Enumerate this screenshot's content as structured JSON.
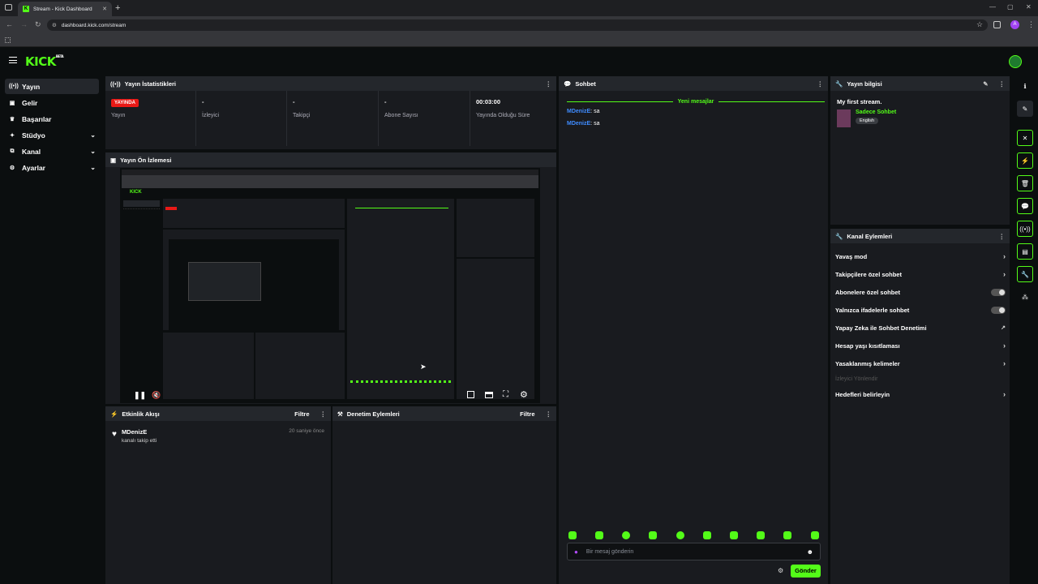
{
  "browser": {
    "tab_title": "Stream - Kick Dashboard",
    "url": "dashboard.kick.com/stream"
  },
  "brand": {
    "logo": "KICK",
    "logo_sup": "BETA",
    "accent": "#53fc18"
  },
  "sidebar": {
    "items": [
      {
        "label": "Yayın",
        "icon": "broadcast-icon",
        "active": true
      },
      {
        "label": "Gelir",
        "icon": "wallet-icon"
      },
      {
        "label": "Başarılar",
        "icon": "trophy-icon"
      },
      {
        "label": "Stüdyo",
        "icon": "studio-icon",
        "expandable": true
      },
      {
        "label": "Kanal",
        "icon": "channel-icon",
        "expandable": true
      },
      {
        "label": "Ayarlar",
        "icon": "gear-icon",
        "expandable": true
      }
    ]
  },
  "stats": {
    "title": "Yayın İstatistikleri",
    "live_badge": "YAYINDA",
    "items": [
      {
        "value": "",
        "label": "Yayın"
      },
      {
        "value": "-",
        "label": "İzleyici"
      },
      {
        "value": "-",
        "label": "Takipçi"
      },
      {
        "value": "-",
        "label": "Abone Sayısı"
      },
      {
        "value": "00:03:00",
        "label": "Yayında Olduğu Süre"
      }
    ]
  },
  "preview": {
    "title": "Yayın Ön İzlemesi"
  },
  "activity": {
    "title": "Etkinlik Akışı",
    "filter": "Filtre",
    "events": [
      {
        "user": "MDenizE",
        "text": "kanalı takip etti",
        "time": "20 saniye önce"
      }
    ]
  },
  "moderation": {
    "title": "Denetim Eylemleri",
    "filter": "Filtre"
  },
  "chat": {
    "title": "Sohbet",
    "new_messages": "Yeni mesajlar",
    "messages": [
      {
        "user": "MDenizE",
        "text": "sa"
      },
      {
        "user": "MDenizE",
        "text": "sa"
      }
    ],
    "input_placeholder": "Bir mesaj gönderin",
    "send": "Gönder"
  },
  "stream_info": {
    "title": "Yayın bilgisi",
    "stream_title": "My first stream.",
    "category": "Sadece Sohbet",
    "language": "English"
  },
  "channel_actions": {
    "title": "Kanal Eylemleri",
    "items": [
      {
        "label": "Yavaş mod",
        "kind": "chevron"
      },
      {
        "label": "Takipçilere özel sohbet",
        "kind": "chevron"
      },
      {
        "label": "Abonelere özel sohbet",
        "kind": "toggle"
      },
      {
        "label": "Yalnızca ifadelerle sohbet",
        "kind": "toggle"
      },
      {
        "label": "Yapay Zeka ile Sohbet Denetimi",
        "kind": "external"
      },
      {
        "label": "Hesap yaşı kısıtlaması",
        "kind": "chevron"
      },
      {
        "label": "Yasaklanmış kelimeler",
        "kind": "chevron"
      },
      {
        "label": "İzleyici Yönlendir",
        "kind": "disabled"
      },
      {
        "label": "Hedefleri belirleyin",
        "kind": "chevron"
      }
    ]
  }
}
